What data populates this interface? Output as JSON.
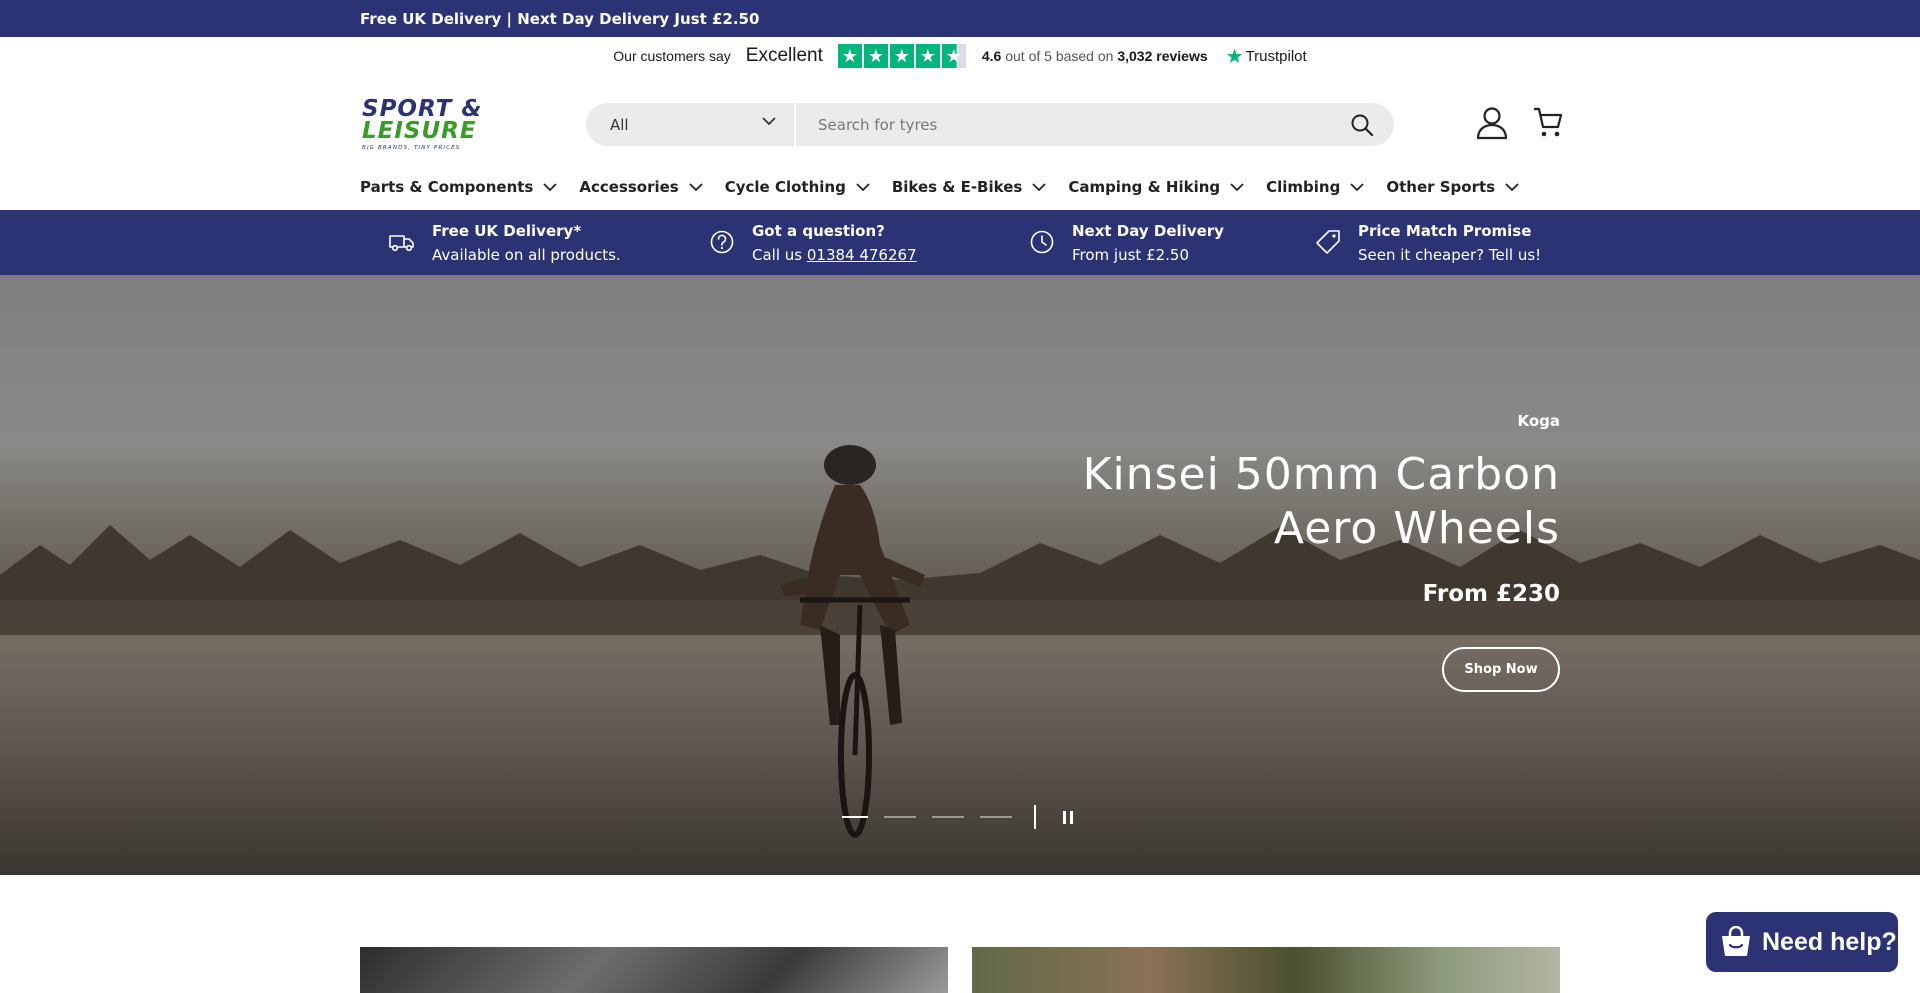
{
  "announcement": {
    "text": "Free UK Delivery | Next Day Delivery Just £2.50"
  },
  "trustpilot": {
    "prefix": "Our customers say",
    "rating_word": "Excellent",
    "score": "4.6",
    "score_mid": " out of 5 based on ",
    "review_count": "3,032 reviews",
    "brand": "Trustpilot",
    "stars": 4.6,
    "color": "#00b67a"
  },
  "header": {
    "logo_line1": "SPORT &",
    "logo_line2": "LEISURE",
    "logo_tagline": "BIG BRANDS, TINY PRICES",
    "search": {
      "category": "All",
      "placeholder": "Search for tyres"
    },
    "icons": {
      "account": "account-icon",
      "cart": "cart-icon",
      "search": "search-icon"
    }
  },
  "nav": {
    "items": [
      {
        "label": "Parts & Components"
      },
      {
        "label": "Accessories"
      },
      {
        "label": "Cycle Clothing"
      },
      {
        "label": "Bikes & E-Bikes"
      },
      {
        "label": "Camping & Hiking"
      },
      {
        "label": "Climbing"
      },
      {
        "label": "Other Sports"
      }
    ]
  },
  "usp": {
    "items": [
      {
        "icon": "truck-icon",
        "title": "Free UK Delivery*",
        "sub": "Available on all products."
      },
      {
        "icon": "question-icon",
        "title": "Got a question?",
        "sub_prefix": "Call us ",
        "phone": "01384 476267"
      },
      {
        "icon": "clock-icon",
        "title": "Next Day Delivery",
        "sub": "From just £2.50"
      },
      {
        "icon": "tag-icon",
        "title": "Price Match Promise",
        "sub": "Seen it cheaper? Tell us!"
      }
    ]
  },
  "hero": {
    "brand": "Koga",
    "title": "Kinsei 50mm Carbon Aero Wheels",
    "price": "From £230",
    "cta": "Shop Now",
    "slide_count": 4,
    "active_slide": 1
  },
  "chat": {
    "label": "Need help?"
  },
  "colors": {
    "brand_navy": "#2c3374",
    "logo_blue": "#2c3374",
    "logo_green": "#3a9a2a",
    "search_bg": "#ebebeb"
  }
}
